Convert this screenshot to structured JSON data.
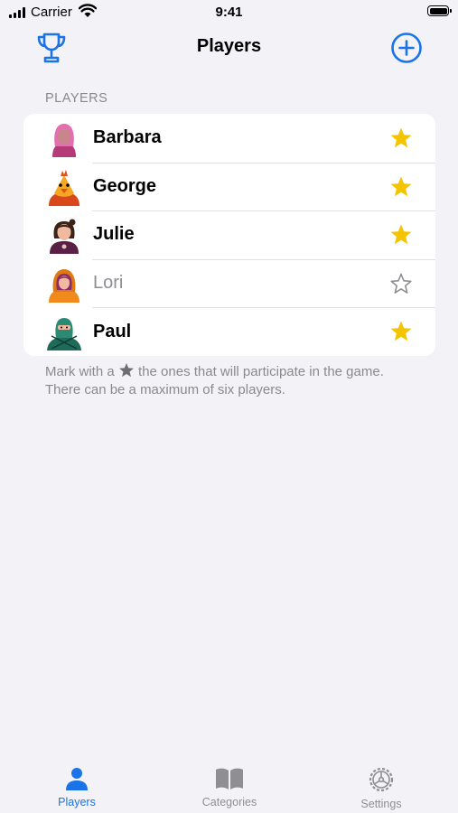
{
  "status_bar": {
    "carrier": "Carrier",
    "time": "9:41"
  },
  "nav": {
    "title": "Players",
    "left_icon": "trophy-icon",
    "right_icon": "plus-circle-icon"
  },
  "section_header": "PLAYERS",
  "players": [
    {
      "name": "Barbara",
      "selected": true,
      "avatar": "avatar-pink-hair"
    },
    {
      "name": "George",
      "selected": true,
      "avatar": "avatar-orange-bird"
    },
    {
      "name": "Julie",
      "selected": true,
      "avatar": "avatar-brunette"
    },
    {
      "name": "Lori",
      "selected": false,
      "avatar": "avatar-orange-hood"
    },
    {
      "name": "Paul",
      "selected": true,
      "avatar": "avatar-green-ninja"
    }
  ],
  "footer_note": {
    "before_star": "Mark with a",
    "after_star": "the ones that will participate in the game. There can be a maximum of six players."
  },
  "tabs": [
    {
      "label": "Players",
      "icon": "person-icon",
      "active": true
    },
    {
      "label": "Categories",
      "icon": "book-icon",
      "active": false
    },
    {
      "label": "Settings",
      "icon": "gear-icon",
      "active": false
    }
  ],
  "colors": {
    "accent": "#1a73e8",
    "star_selected": "#f5c400",
    "star_unselected": "#8e8e93",
    "background": "#f2f2f7"
  }
}
